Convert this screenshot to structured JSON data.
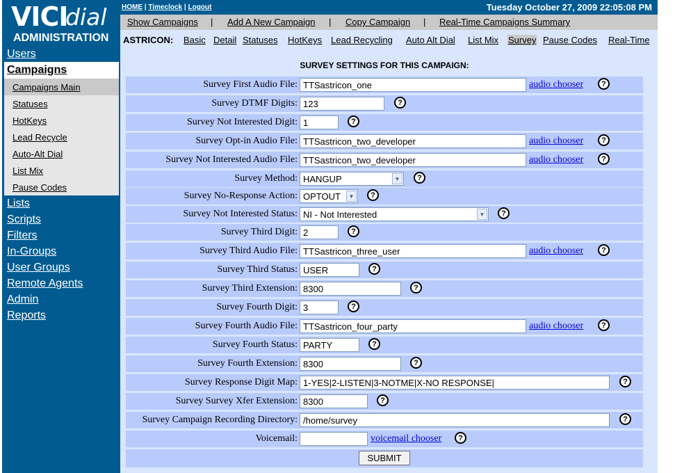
{
  "logo": {
    "vici": "VICI",
    "dial": "dial"
  },
  "sidebar": {
    "admin_title": "ADMINISTRATION",
    "items": [
      "Users",
      "Campaigns",
      "Lists",
      "Scripts",
      "Filters",
      "In-Groups",
      "User Groups",
      "Remote Agents",
      "Admin",
      "Reports"
    ],
    "campaign_sub": [
      "Campaigns Main",
      "Statuses",
      "HotKeys",
      "Lead Recycle",
      "Auto-Alt Dial",
      "List Mix",
      "Pause Codes"
    ]
  },
  "header": {
    "home": "HOME",
    "timeclock": "Timeclock",
    "logout": "Logout",
    "sep": "|",
    "datetime": "Tuesday October 27, 2009 22:05:08 PM"
  },
  "campaign_nav": {
    "show": "Show Campaigns",
    "add": "Add A New Campaign",
    "copy": "Copy Campaign",
    "summary": "Real-Time Campaigns Summary",
    "sep": "|"
  },
  "tabs": {
    "campaign_id": "ASTRICON:",
    "items": [
      "Basic",
      "Detail",
      "Statuses",
      "HotKeys",
      "Lead Recycling",
      "Auto Alt Dial",
      "List Mix",
      "Survey",
      "Pause Codes",
      "Real-Time"
    ]
  },
  "section_title": "SURVEY SETTINGS FOR THIS CAMPAIGN:",
  "audio_chooser": "audio chooser",
  "voicemail_chooser": "voicemail chooser",
  "help_glyph": "?",
  "fields": {
    "first_audio": {
      "label": "Survey First Audio File:",
      "value": "TTSastricon_one"
    },
    "dtmf_digits": {
      "label": "Survey DTMF Digits:",
      "value": "123"
    },
    "ni_digit": {
      "label": "Survey Not Interested Digit:",
      "value": "1"
    },
    "optin_audio": {
      "label": "Survey Opt-in Audio File:",
      "value": "TTSastricon_two_developer"
    },
    "ni_audio": {
      "label": "Survey Not Interested Audio File:",
      "value": "TTSastricon_two_developer"
    },
    "method": {
      "label": "Survey Method:",
      "value": "HANGUP"
    },
    "no_response": {
      "label": "Survey No-Response Action:",
      "value": "OPTOUT"
    },
    "ni_status": {
      "label": "Survey Not Interested Status:",
      "value": "NI - Not Interested"
    },
    "third_digit": {
      "label": "Survey Third Digit:",
      "value": "2"
    },
    "third_audio": {
      "label": "Survey Third Audio File:",
      "value": "TTSastricon_three_user"
    },
    "third_status": {
      "label": "Survey Third Status:",
      "value": "USER"
    },
    "third_ext": {
      "label": "Survey Third Extension:",
      "value": "8300"
    },
    "fourth_digit": {
      "label": "Survey Fourth Digit:",
      "value": "3"
    },
    "fourth_audio": {
      "label": "Survey Fourth Audio File:",
      "value": "TTSastricon_four_party"
    },
    "fourth_status": {
      "label": "Survey Fourth Status:",
      "value": "PARTY"
    },
    "fourth_ext": {
      "label": "Survey Fourth Extension:",
      "value": "8300"
    },
    "digit_map": {
      "label": "Survey Response Digit Map:",
      "value": "1-YES|2-LISTEN|3-NOTME|X-NO RESPONSE|"
    },
    "xfer_ext": {
      "label": "Survey Survey Xfer Extension:",
      "value": "8300"
    },
    "rec_dir": {
      "label": "Survey Campaign Recording Directory:",
      "value": "/home/survey"
    },
    "voicemail": {
      "label": "Voicemail:",
      "value": ""
    }
  },
  "submit": "SUBMIT",
  "colors": {
    "sidebar": "#015B91",
    "panel": "#D9E6FE",
    "row": "#B9CBFD",
    "link": "#0000CC"
  }
}
